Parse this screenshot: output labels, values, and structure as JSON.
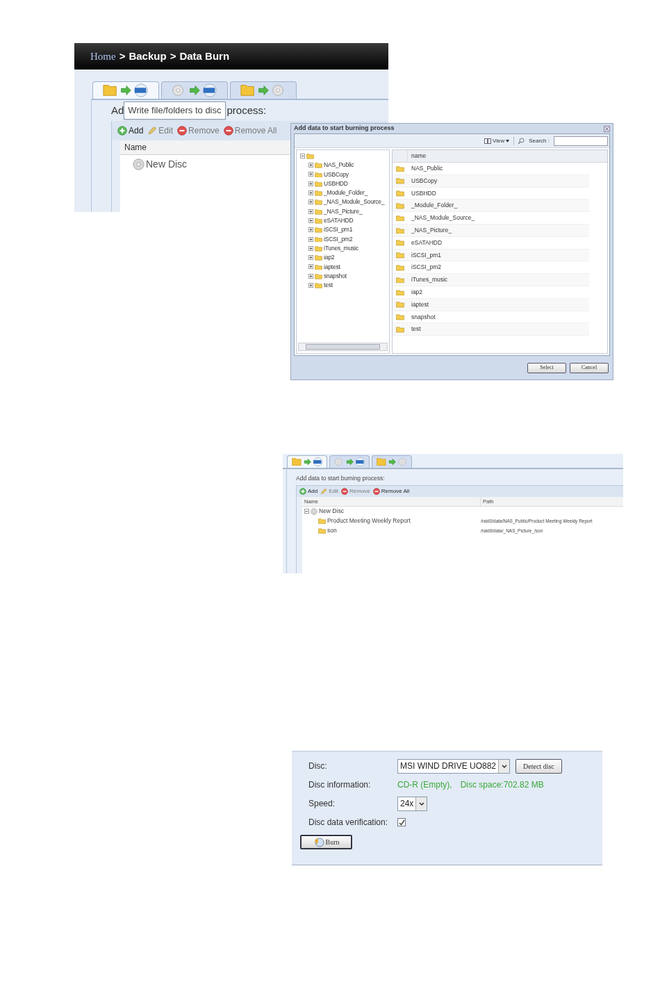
{
  "screen_1": {
    "breadcrumb": [
      "Home",
      "Backup",
      "Data Burn"
    ],
    "separator": ">",
    "tabs": [
      {
        "kind": "write",
        "selected": true
      },
      {
        "kind": "copy",
        "selected": false
      },
      {
        "kind": "image",
        "selected": false
      }
    ],
    "heading_start": "Ad",
    "tooltip": "Write file/folders to disc",
    "heading_end": "process:",
    "toolbar": [
      {
        "label": "Add",
        "kind": "add",
        "disabled": false
      },
      {
        "label": "Edit",
        "kind": "edit",
        "disabled": true
      },
      {
        "label": "Remove",
        "kind": "remove",
        "disabled": true
      },
      {
        "label": "Remove All",
        "kind": "remove",
        "disabled": true
      }
    ],
    "columns": [
      "Name"
    ],
    "tree": [
      {
        "label": "New Disc",
        "kind": "disc"
      }
    ]
  },
  "dialog": {
    "title": "Add data to start burning process",
    "view_button": "View",
    "search_label": "Search :",
    "tree_root": {
      "expanded": true,
      "children": [
        {
          "label": "NAS_Public",
          "expanded": false
        },
        {
          "label": "USBCopy",
          "expanded": false
        },
        {
          "label": "USBHDD",
          "expanded": false
        },
        {
          "label": "_Module_Folder_",
          "expanded": false
        },
        {
          "label": "_NAS_Module_Source_",
          "expanded": false
        },
        {
          "label": "_NAS_Picture_",
          "expanded": false
        },
        {
          "label": "eSATAHDD",
          "expanded": false
        },
        {
          "label": "iSCSI_pm1",
          "expanded": false
        },
        {
          "label": "iSCSI_pm2",
          "expanded": false
        },
        {
          "label": "iTunes_music",
          "expanded": false
        },
        {
          "label": "iap2",
          "expanded": false
        },
        {
          "label": "iaptest",
          "expanded": false
        },
        {
          "label": "snapshot",
          "expanded": false
        },
        {
          "label": "test",
          "expanded": false
        }
      ]
    },
    "columns": [
      "name"
    ],
    "rows": [
      "NAS_Public",
      "USBCopy",
      "USBHDD",
      "_Module_Folder_",
      "_NAS_Module_Source_",
      "_NAS_Picture_",
      "eSATAHDD",
      "iSCSI_pm1",
      "iSCSI_pm2",
      "iTunes_music",
      "iap2",
      "iaptest",
      "snapshot",
      "test"
    ],
    "buttons": [
      "Select",
      "Cancel"
    ]
  },
  "screen_2": {
    "tabs": [
      {
        "kind": "write",
        "selected": true
      },
      {
        "kind": "copy",
        "selected": false
      },
      {
        "kind": "image",
        "selected": false
      }
    ],
    "heading": "Add data to start burning process:",
    "toolbar": [
      {
        "label": "Add",
        "kind": "add",
        "disabled": false
      },
      {
        "label": "Edit",
        "kind": "edit",
        "disabled": true
      },
      {
        "label": "Remove",
        "kind": "remove",
        "disabled": true
      },
      {
        "label": "Remove All",
        "kind": "remove",
        "disabled": false
      }
    ],
    "columns": [
      "Name",
      "Path"
    ],
    "tree": [
      {
        "label": "New Disc",
        "kind": "disc",
        "expanded": true,
        "children": [
          {
            "label": "Product Meeting Weekly Report",
            "kind": "folder",
            "path": "/raid0/data/NAS_Public/Product Meeting Weekly Report"
          },
          {
            "label": "son",
            "kind": "folder",
            "path": "/raid0/data/_NAS_Picture_/son"
          }
        ]
      }
    ]
  },
  "screen_3": {
    "fields": [
      {
        "kind": "select",
        "label": "Disc:",
        "value": "MSI WIND DRIVE UO882",
        "button": "Detect disc"
      },
      {
        "kind": "info",
        "label": "Disc information:",
        "values": [
          "CD-R (Empty),",
          "Disc space:702.82 MB"
        ]
      },
      {
        "kind": "select",
        "label": "Speed:",
        "value": "24x"
      },
      {
        "kind": "checkbox",
        "label": "Disc data verification:",
        "checked": true
      }
    ],
    "action": "Burn"
  }
}
